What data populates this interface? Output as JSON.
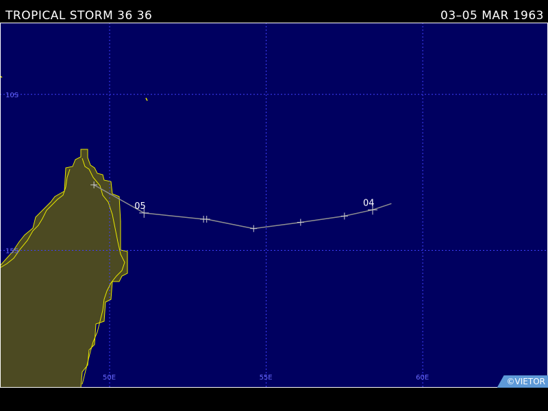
{
  "header": {
    "storm_name": "TROPICAL STORM 36 36",
    "date_range": "03–05 MAR 1963"
  },
  "credit": "©VIETOR",
  "colors": {
    "ocean": "#000060",
    "land": "#4c4a22",
    "coast": "#e8e800",
    "grid": "#4040ff",
    "grid_label": "#6a6aff",
    "track": "#909090",
    "marker": "#d0d0d0",
    "frame": "#ffffff"
  },
  "map": {
    "lon_range": [
      46.5,
      64.0
    ],
    "lat_range": [
      7.7,
      19.4
    ],
    "grid_lines": {
      "lat": [
        {
          "value": -10,
          "label": "10S"
        },
        {
          "value": -15,
          "label": "15S"
        }
      ],
      "lon": [
        {
          "value": 50,
          "label": "50E"
        },
        {
          "value": 55,
          "label": "55E"
        },
        {
          "value": 60,
          "label": "60E"
        }
      ]
    },
    "track": {
      "points": [
        {
          "lon": 59.0,
          "lat": -13.5
        },
        {
          "lon": 58.4,
          "lat": -13.7,
          "label": "04"
        },
        {
          "lon": 57.5,
          "lat": -13.9
        },
        {
          "lon": 56.1,
          "lat": -14.1
        },
        {
          "lon": 54.6,
          "lat": -14.3
        },
        {
          "lon": 53.1,
          "lat": -14.0
        },
        {
          "lon": 53.0,
          "lat": -14.0
        },
        {
          "lon": 51.1,
          "lat": -13.8,
          "label": "05"
        },
        {
          "lon": 49.5,
          "lat": -12.9
        }
      ]
    }
  }
}
